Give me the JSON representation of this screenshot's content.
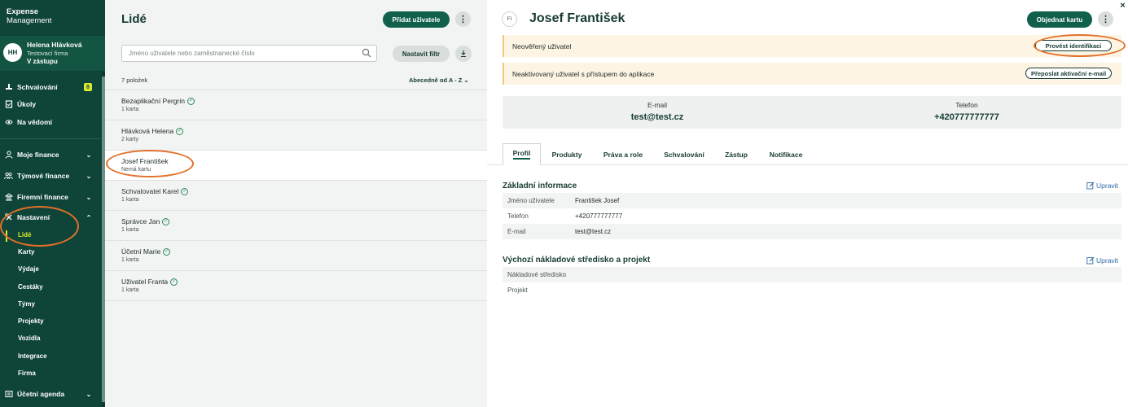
{
  "sidebar": {
    "brand_line1": "Expense",
    "brand_line2": "Management",
    "user": {
      "initials": "HH",
      "name": "Helena Hlávková",
      "company": "Testovací firma",
      "role": "V zástupu"
    },
    "nav_top": [
      {
        "label": "Schvalování",
        "badge": "8",
        "icon": "stamp-icon"
      },
      {
        "label": "Úkoly",
        "icon": "task-icon"
      },
      {
        "label": "Na vědomí",
        "icon": "eye-icon"
      }
    ],
    "nav_groups": [
      {
        "label": "Moje finance",
        "icon": "person-icon",
        "chevron": "down"
      },
      {
        "label": "Týmové finance",
        "icon": "team-icon",
        "chevron": "down"
      },
      {
        "label": "Firemní finance",
        "icon": "building-icon",
        "chevron": "down"
      },
      {
        "label": "Nastavení",
        "icon": "settings-icon",
        "chevron": "up"
      }
    ],
    "settings_items": [
      "Lidé",
      "Karty",
      "Výdaje",
      "Cestáky",
      "Týmy",
      "Projekty",
      "Vozidla",
      "Integrace",
      "Firma"
    ],
    "nav_bottom": {
      "label": "Účetní agenda",
      "icon": "ledger-icon",
      "chevron": "down"
    }
  },
  "list": {
    "title": "Lidé",
    "add_user_label": "Přidat uživatele",
    "search_placeholder": "Jméno uživatele nebo zaměstnanecké číslo",
    "filter_label": "Nastavit filtr",
    "count_label": "7 položek",
    "sort_label": "Abecedně od A - Z",
    "rows": [
      {
        "name": "Bezaplikační Pergrin",
        "sub": "1 karta",
        "verified": true
      },
      {
        "name": "Hlávková Helena",
        "sub": "2 karty",
        "verified": true
      },
      {
        "name": "Josef František",
        "sub": "Nemá kartu",
        "verified": false
      },
      {
        "name": "Schvalovatel Karel",
        "sub": "1 karta",
        "verified": true
      },
      {
        "name": "Správce Jan",
        "sub": "1 karta",
        "verified": true
      },
      {
        "name": "Účetní Marie",
        "sub": "1 karta",
        "verified": true
      },
      {
        "name": "Uživatel Franta",
        "sub": "1 karta",
        "verified": true
      }
    ]
  },
  "detail": {
    "initials": "FI",
    "title": "Josef František",
    "order_card_label": "Objednat kartu",
    "close_glyph": "×",
    "alerts": [
      {
        "text": "Neověřený uživatel",
        "action": "Provést identifikaci"
      },
      {
        "text": "Neaktivovaný uživatel s přístupem do aplikace",
        "action": "Přeposlat aktivační e-mail"
      }
    ],
    "contact": {
      "email_label": "E-mail",
      "email": "test@test.cz",
      "phone_label": "Telefon",
      "phone": "+420777777777"
    },
    "tabs": [
      "Profil",
      "Produkty",
      "Práva a role",
      "Schvalování",
      "Zástup",
      "Notifikace"
    ],
    "basic": {
      "title": "Základní informace",
      "edit_label": "Upravit",
      "rows": [
        {
          "key": "Jméno uživatele",
          "value": "František Josef"
        },
        {
          "key": "Telefon",
          "value": "+420777777777"
        },
        {
          "key": "E-mail",
          "value": "test@test.cz"
        }
      ]
    },
    "cost": {
      "title": "Výchozí nákladové středisko a projekt",
      "edit_label": "Upravit",
      "rows": [
        {
          "key": "Nákladové středisko",
          "value": ""
        },
        {
          "key": "Projekt",
          "value": ""
        }
      ]
    }
  },
  "colors": {
    "sidebar": "#0f4438",
    "accent": "#d7ea2f",
    "primary": "#10604b",
    "annotation": "#e2702a"
  }
}
